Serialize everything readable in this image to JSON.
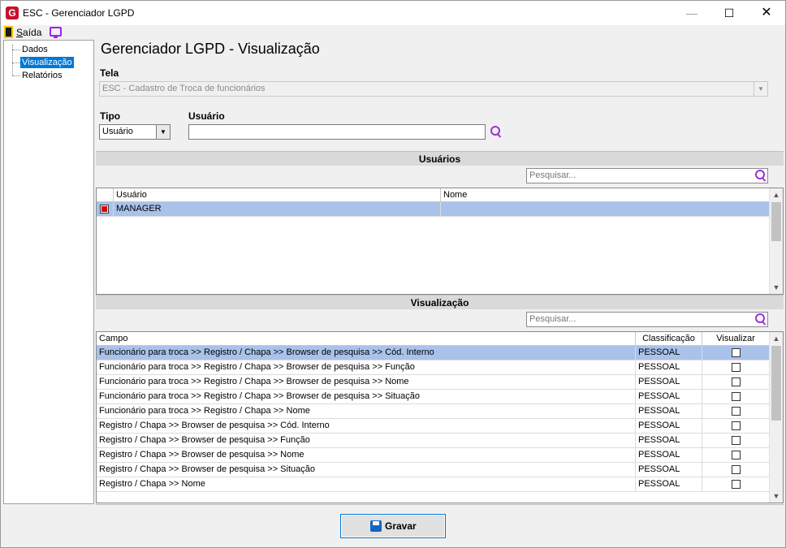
{
  "window": {
    "title": "ESC - Gerenciador LGPD",
    "logo_letter": "G",
    "min_glyph": "—",
    "max_glyph": "☐",
    "close_glyph": "✕"
  },
  "menu": {
    "exit_label": "Saída"
  },
  "tree": {
    "items": [
      "Dados",
      "Visualização",
      "Relatórios"
    ],
    "selected": "Visualização"
  },
  "page_title": "Gerenciador LGPD - Visualização",
  "tela": {
    "label": "Tela",
    "value": "ESC - Cadastro de Troca de funcionários"
  },
  "tipo": {
    "label": "Tipo",
    "value": "Usuário"
  },
  "usuario": {
    "label": "Usuário",
    "value": ""
  },
  "usuarios_section": {
    "header": "Usuários",
    "search_placeholder": "Pesquisar...",
    "columns": [
      "Usuário",
      "Nome"
    ],
    "rows": [
      {
        "checked": true,
        "usuario": "MANAGER",
        "nome": "",
        "selected": true
      }
    ]
  },
  "visualizacao_section": {
    "header": "Visualização",
    "search_placeholder": "Pesquisar...",
    "columns": [
      "Campo",
      "Classificação",
      "Visualizar"
    ],
    "rows": [
      {
        "campo": "Funcionário para troca >> Registro / Chapa  >> Browser de pesquisa >> Cód. Interno",
        "classificacao": "PESSOAL",
        "visualizar": false,
        "selected": true
      },
      {
        "campo": "Funcionário para troca >> Registro / Chapa  >> Browser de pesquisa >> Função",
        "classificacao": "PESSOAL",
        "visualizar": false
      },
      {
        "campo": "Funcionário para troca >> Registro / Chapa  >> Browser de pesquisa >> Nome",
        "classificacao": "PESSOAL",
        "visualizar": false
      },
      {
        "campo": "Funcionário para troca >> Registro / Chapa  >> Browser de pesquisa >> Situação",
        "classificacao": "PESSOAL",
        "visualizar": false
      },
      {
        "campo": "Funcionário para troca >> Registro / Chapa >> Nome",
        "classificacao": "PESSOAL",
        "visualizar": false
      },
      {
        "campo": "Registro / Chapa >> Browser de pesquisa >> Cód. Interno",
        "classificacao": "PESSOAL",
        "visualizar": false
      },
      {
        "campo": "Registro / Chapa >> Browser de pesquisa >> Função",
        "classificacao": "PESSOAL",
        "visualizar": false
      },
      {
        "campo": "Registro / Chapa >> Browser de pesquisa >> Nome",
        "classificacao": "PESSOAL",
        "visualizar": false
      },
      {
        "campo": "Registro / Chapa >> Browser de pesquisa >> Situação",
        "classificacao": "PESSOAL",
        "visualizar": false
      },
      {
        "campo": "Registro / Chapa >> Nome",
        "classificacao": "PESSOAL",
        "visualizar": false
      }
    ]
  },
  "save_button": {
    "label": "Gravar"
  },
  "colors": {
    "selection_row": "#a9c2ea",
    "tree_selection": "#0078d7",
    "search_icon": "#9b30d9",
    "logo": "#c8102e"
  },
  "icons": [
    "app-logo-icon",
    "exit-door-icon",
    "monitor-icon",
    "search-icon",
    "save-disk-icon",
    "chevron-up-icon",
    "chevron-down-icon",
    "checkbox-icon"
  ]
}
